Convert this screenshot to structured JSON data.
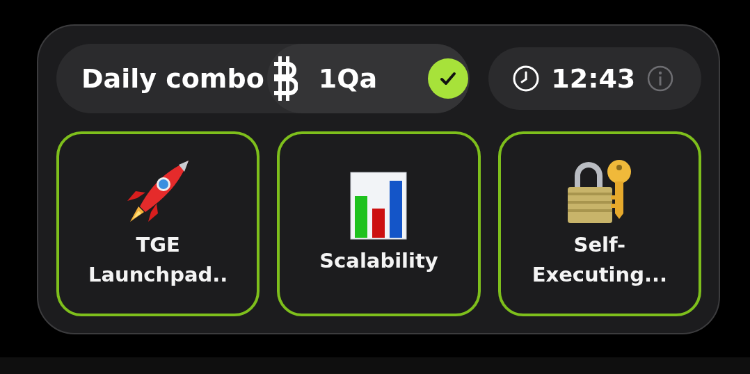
{
  "combo": {
    "title": "Daily combo",
    "reward": "1Qa",
    "completed": true
  },
  "timer": {
    "time": "12:43"
  },
  "cards": [
    {
      "label": "TGE Launchpad..",
      "kind": "rocket"
    },
    {
      "label": "Scalability",
      "kind": "chart"
    },
    {
      "label": "Self-Executing...",
      "kind": "lock"
    }
  ]
}
